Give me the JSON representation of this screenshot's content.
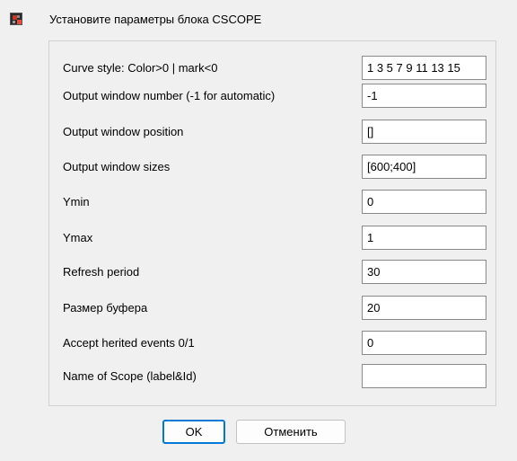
{
  "dialog": {
    "title": "Установите параметры блока CSCOPE",
    "icon": "scicos-app-icon"
  },
  "fields": [
    {
      "label": "Curve style: Color>0 | mark<0",
      "value": "1 3 5 7 9 11 13 15"
    },
    {
      "label": "Output window number (-1 for automatic)",
      "value": "-1"
    },
    {
      "label": "Output window position",
      "value": "[]"
    },
    {
      "label": "Output window sizes",
      "value": "[600;400]"
    },
    {
      "label": "Ymin",
      "value": "0"
    },
    {
      "label": "Ymax",
      "value": "1"
    },
    {
      "label": "Refresh period",
      "value": "30"
    },
    {
      "label": "Размер буфера",
      "value": "20"
    },
    {
      "label": "Accept herited events 0/1",
      "value": "0"
    },
    {
      "label": "Name of Scope (label&Id)",
      "value": ""
    }
  ],
  "buttons": {
    "ok": "OK",
    "cancel": "Отменить"
  },
  "colors": {
    "focus_border": "#0078d4"
  }
}
